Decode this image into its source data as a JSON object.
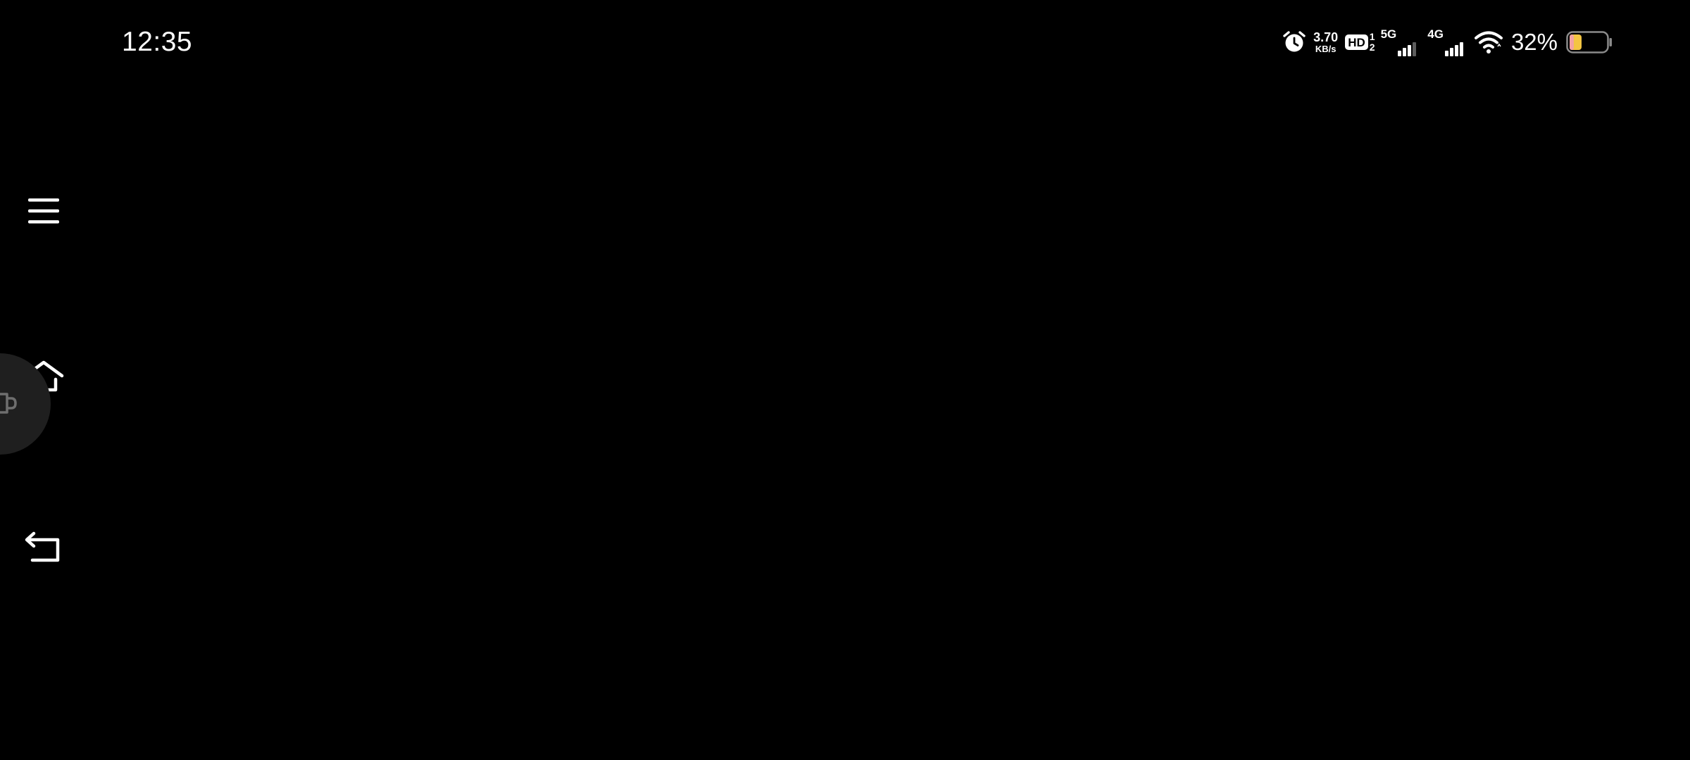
{
  "status_bar": {
    "time": "12:35",
    "alarm_icon": "alarm-clock-icon",
    "network_speed": {
      "value": "3.70",
      "unit": "KB/s"
    },
    "hd_voice": {
      "label": "HD",
      "sim_1": "1",
      "sim_2": "2"
    },
    "sim1_network": {
      "type": "5G",
      "bars_total": 4,
      "bars_active": 3
    },
    "sim2_network": {
      "type": "4G",
      "bars_total": 4,
      "bars_active": 4
    },
    "wifi_icon": "wifi-icon",
    "battery": {
      "percent_text": "32%",
      "level": 0.32,
      "charging_color": "#f4c542"
    }
  },
  "navigation": {
    "buttons": [
      {
        "name": "menu",
        "icon": "hamburger-menu-icon"
      },
      {
        "name": "home",
        "icon": "home-icon"
      },
      {
        "name": "back",
        "icon": "back-arrow-icon"
      }
    ]
  },
  "floating_bubble": {
    "icon": "cup-icon"
  },
  "colors": {
    "background": "#000000",
    "foreground": "#ffffff",
    "bubble": "#1f1f1f",
    "dim": "#5c5c5c"
  }
}
